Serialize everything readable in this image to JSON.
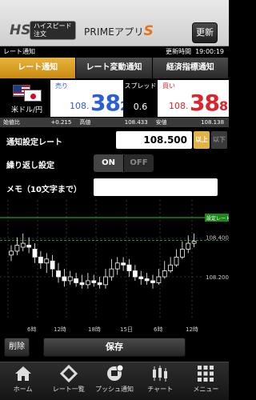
{
  "header": {
    "hs_mark": "HS",
    "hs_badge": "ハイスピード注文",
    "app_name": "PRIMEアプリ",
    "app_name_suffix": "S",
    "refresh_label": "更新"
  },
  "subbar": {
    "left": "レート通知",
    "right_label": "更新時間",
    "right_time": "19:00:19"
  },
  "tabs": [
    {
      "label": "レート通知",
      "active": true
    },
    {
      "label": "レート変動通知",
      "active": false
    },
    {
      "label": "経済指標通知",
      "active": false
    }
  ],
  "pair": {
    "label": "米ドル/円",
    "flag1": "us-flag-icon",
    "flag2": "jp-flag-icon"
  },
  "sell": {
    "label": "売り",
    "price_prefix": "108.",
    "price_big": "38",
    "price_sub": "2"
  },
  "spread": {
    "label": "スプレッド",
    "value": "0.6"
  },
  "buy": {
    "label": "買い",
    "price_prefix": "108.",
    "price_big": "38",
    "price_sub": "8"
  },
  "stats": {
    "open_label": "始値比",
    "open_value": "+0.215",
    "high_label": "高値",
    "high_value": "108.433",
    "low_label": "安値",
    "low_value": "108.138"
  },
  "notify": {
    "rate_label": "通知設定レート",
    "rate_value": "108.500",
    "above_label": "以上",
    "below_label": "以下",
    "repeat_label": "繰り返し設定",
    "on_label": "ON",
    "off_label": "OFF",
    "memo_label": "メモ（10文字まで）",
    "memo_value": ""
  },
  "chart_data": {
    "type": "candlestick",
    "x_ticks": [
      "6時",
      "12時",
      "18時",
      "15日",
      "6時",
      "12時"
    ],
    "y_ticks": [
      "108.400",
      "108.200"
    ],
    "setting_line_label": "設定レート",
    "setting_line_value": 108.5,
    "current_line_value": 108.385,
    "colors": {
      "up": "#ffffff",
      "down": "#ffffff",
      "setting_line": "#22cc22",
      "current_line": "#22cc22"
    }
  },
  "actions": {
    "delete_label": "削除",
    "save_label": "保存"
  },
  "nav": [
    {
      "label": "ホーム",
      "icon": "home-icon"
    },
    {
      "label": "レート一覧",
      "icon": "rate-list-icon"
    },
    {
      "label": "プッシュ通知",
      "icon": "push-notify-icon"
    },
    {
      "label": "チャート",
      "icon": "chart-icon"
    },
    {
      "label": "メニュー",
      "icon": "menu-icon"
    }
  ]
}
